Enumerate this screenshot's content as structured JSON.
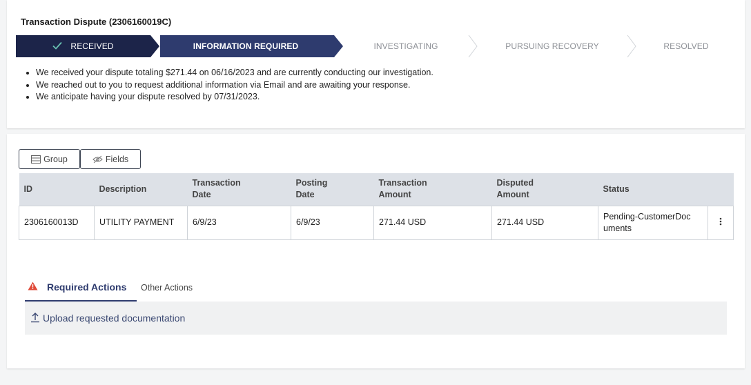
{
  "header": {
    "title": "Transaction Dispute (2306160019C)"
  },
  "stepper": {
    "steps": [
      {
        "label": "RECEIVED",
        "state": "done"
      },
      {
        "label": "INFORMATION REQUIRED",
        "state": "current"
      },
      {
        "label": "INVESTIGATING",
        "state": "todo"
      },
      {
        "label": "PURSUING RECOVERY",
        "state": "todo"
      },
      {
        "label": "RESOLVED",
        "state": "todo"
      }
    ]
  },
  "summary": {
    "bullets": [
      "We received your dispute totaling $271.44 on 06/16/2023 and are currently conducting our investigation.",
      "We reached out to you to request additional information via Email and are awaiting your response.",
      "We anticipate having your dispute resolved by 07/31/2023."
    ]
  },
  "toolbar": {
    "group_label": "Group",
    "fields_label": "Fields"
  },
  "table": {
    "columns": [
      "ID",
      "Description",
      "Transaction Date",
      "Posting Date",
      "Transaction Amount",
      "Disputed Amount",
      "Status"
    ],
    "rows": [
      {
        "id": "2306160013D",
        "description": "UTILITY PAYMENT",
        "transaction_date": "6/9/23",
        "posting_date": "6/9/23",
        "transaction_amount": "271.44 USD",
        "disputed_amount": "271.44 USD",
        "status": "Pending-CustomerDocuments"
      }
    ]
  },
  "actions": {
    "tabs": {
      "required": "Required Actions",
      "other": "Other Actions"
    },
    "required_items": [
      "Upload requested documentation"
    ]
  },
  "colors": {
    "navy_dark": "#1c2449",
    "navy": "#2e3b6e",
    "check_teal": "#69c2b3",
    "warning_red": "#e04b3a"
  },
  "icons": [
    "checkmark-icon",
    "list-icon",
    "eye-slash-icon",
    "kebab-menu-icon",
    "warning-icon",
    "upload-icon"
  ]
}
